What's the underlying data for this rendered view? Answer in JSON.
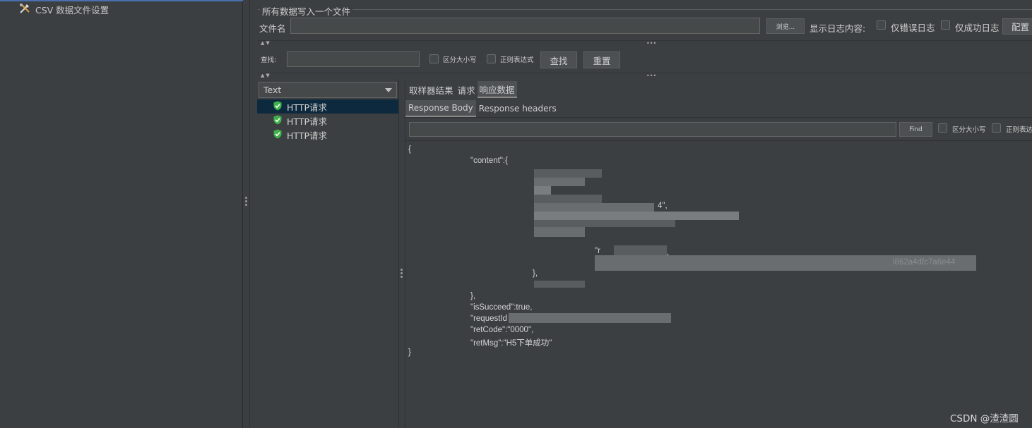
{
  "tree": {
    "item_label": "CSV 数据文件设置"
  },
  "file_section": {
    "legend": "所有数据写入一个文件",
    "filename_label": "文件名",
    "browse_button": "浏览...",
    "log_display_label": "显示日志内容:",
    "errors_only_label": "仅错误日志",
    "success_only_label": "仅成功日志",
    "config_button": "配置"
  },
  "search_bar": {
    "label": "查找:",
    "case_sensitive_label": "区分大小写",
    "regex_label": "正则表达式",
    "find_button": "查找",
    "reset_button": "重置"
  },
  "results": {
    "renderer_selected": "Text",
    "items": [
      {
        "label": "HTTP请求",
        "status": "success"
      },
      {
        "label": "HTTP请求",
        "status": "success"
      },
      {
        "label": "HTTP请求",
        "status": "success"
      }
    ]
  },
  "tabs": {
    "sampler_result": "取样器结果",
    "request": "请求",
    "response_data": "响应数据"
  },
  "subtabs": {
    "response_body": "Response Body",
    "response_headers": "Response headers"
  },
  "body_search": {
    "find_button": "Find",
    "case_sensitive_label": "区分大小写",
    "regex_label": "正则表达式"
  },
  "response_body": {
    "open_brace": "{",
    "content_key": "\"content\":{",
    "fragment_4": "4\",",
    "fragment_r": "\"r",
    "fragment_comma": ",",
    "fragment_hash": "i862a4dfc7a6e44",
    "inner_close": "},",
    "content_close": "},",
    "is_succeeded": "\"isSucceed\":true,",
    "request_id": "\"requestId",
    "ret_code": "\"retCode\":\"0000\",",
    "ret_msg": "\"retMsg\":\"H5下单成功\"",
    "close_brace": "}"
  },
  "watermark": "CSDN @渣渣圆",
  "colors": {
    "background": "#3c3f41",
    "selection": "#0d293e",
    "success_icon": "#3fb24a"
  }
}
